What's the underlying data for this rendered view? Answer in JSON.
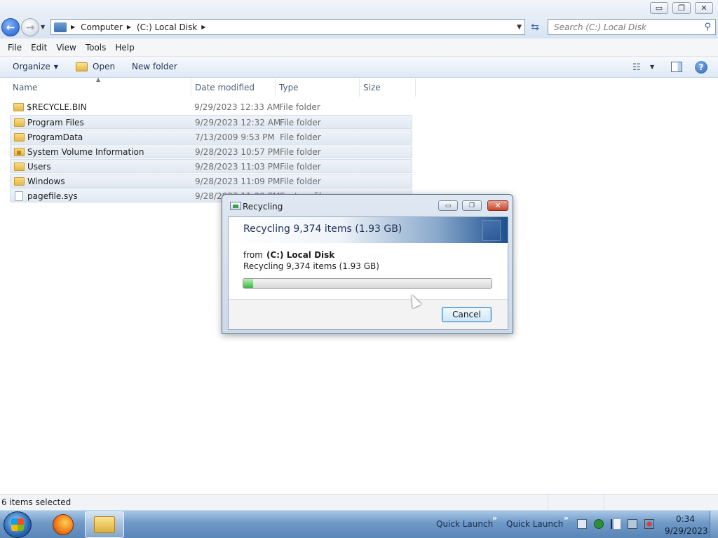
{
  "window": {
    "controls": {
      "minimize": "▭",
      "maximize": "❐",
      "close": "✕"
    }
  },
  "address": {
    "crumbs": [
      "Computer",
      "(C:) Local Disk"
    ],
    "search_placeholder": "Search (C:) Local Disk"
  },
  "menu": [
    "File",
    "Edit",
    "View",
    "Tools",
    "Help"
  ],
  "toolbar": {
    "organize": "Organize",
    "open": "Open",
    "new_folder": "New folder"
  },
  "columns": [
    "Name",
    "Date modified",
    "Type",
    "Size"
  ],
  "files": [
    {
      "name": "$RECYCLE.BIN",
      "date": "9/29/2023 12:33 AM",
      "type": "File folder",
      "size": "",
      "icon": "folder-icon",
      "selected": false
    },
    {
      "name": "Program Files",
      "date": "9/29/2023 12:32 AM",
      "type": "File folder",
      "size": "",
      "icon": "folder-icon",
      "selected": true
    },
    {
      "name": "ProgramData",
      "date": "7/13/2009 9:53 PM",
      "type": "File folder",
      "size": "",
      "icon": "folder-icon",
      "selected": true
    },
    {
      "name": "System Volume Information",
      "date": "9/28/2023 10:57 PM",
      "type": "File folder",
      "size": "",
      "icon": "locked-folder-icon",
      "selected": true
    },
    {
      "name": "Users",
      "date": "9/28/2023 11:03 PM",
      "type": "File folder",
      "size": "",
      "icon": "folder-icon",
      "selected": true
    },
    {
      "name": "Windows",
      "date": "9/28/2023 11:09 PM",
      "type": "File folder",
      "size": "",
      "icon": "folder-icon",
      "selected": true
    },
    {
      "name": "pagefile.sys",
      "date": "9/28/2023 11:09 PM",
      "type": "System file",
      "size": "",
      "icon": "file-icon",
      "selected": true
    }
  ],
  "status": {
    "text": "6 items selected"
  },
  "dialog": {
    "title": "Recycling",
    "heading": "Recycling 9,374 items (1.93 GB)",
    "from_label": "from",
    "from_value": "(C:) Local Disk",
    "status": "Recycling 9,374 items (1.93 GB)",
    "progress_fraction": 0.04,
    "cancel": "Cancel"
  },
  "taskbar": {
    "quick_launch": [
      "Quick Launch",
      "Quick Launch"
    ],
    "quick_launch_chevron": "»",
    "clock_time": "0:34",
    "clock_date": "9/29/2023"
  },
  "colors": {
    "accent": "#1f5cc9",
    "selection": "#e1e9f2",
    "progress": "#3fb24b",
    "close_red": "#c7452c"
  }
}
